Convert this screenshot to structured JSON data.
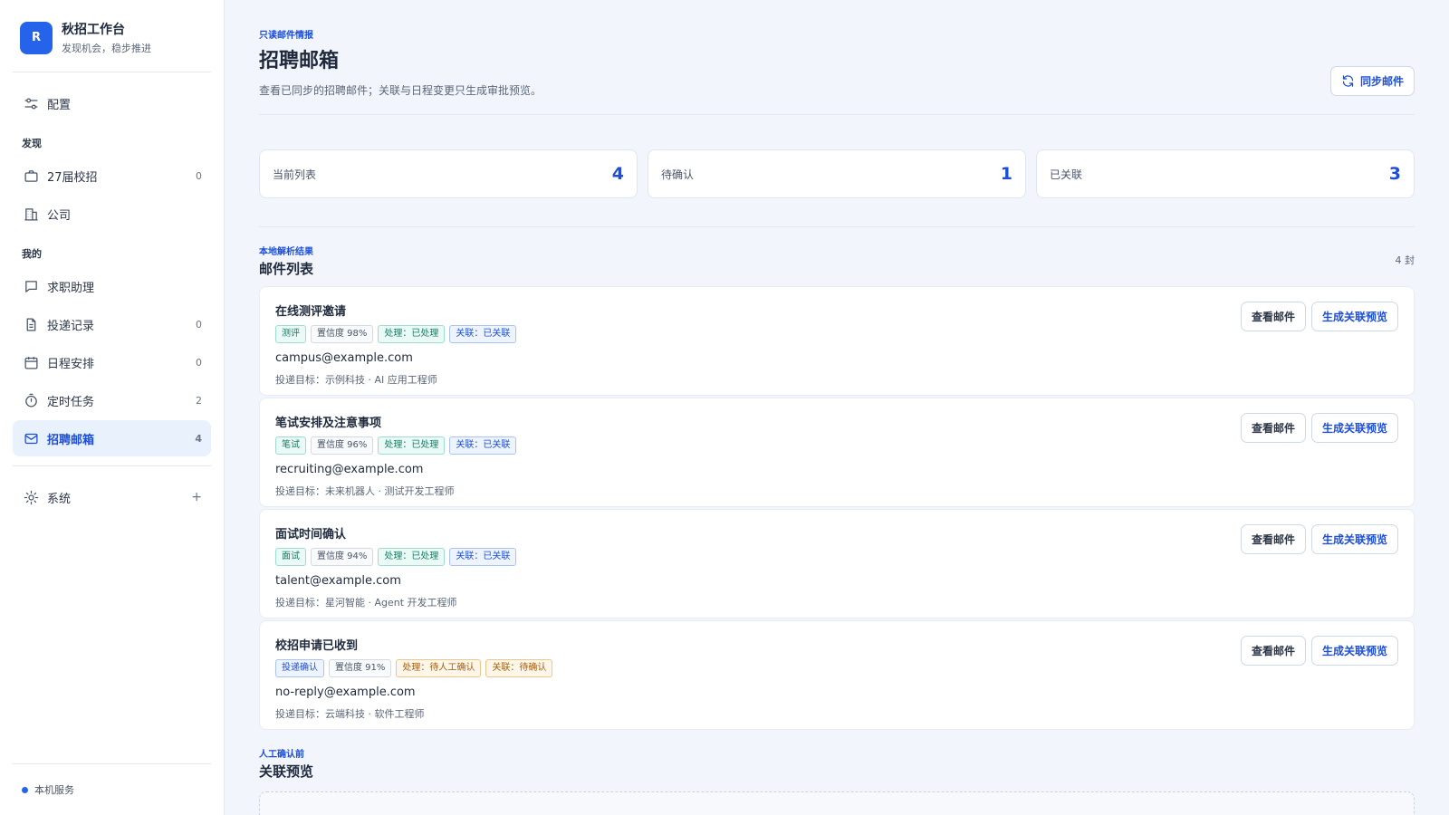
{
  "app": {
    "logo_letter": "R",
    "title": "秋招工作台",
    "subtitle": "发现机会，稳步推进"
  },
  "sidebar": {
    "config_label": "配置",
    "section_discover": "发现",
    "section_mine": "我的",
    "items": [
      {
        "label": "27届校招",
        "count": "0",
        "icon": "briefcase-icon"
      },
      {
        "label": "公司",
        "count": "",
        "icon": "building-icon"
      },
      {
        "label": "求职助理",
        "count": "",
        "icon": "chat-icon"
      },
      {
        "label": "投递记录",
        "count": "0",
        "icon": "document-icon"
      },
      {
        "label": "日程安排",
        "count": "0",
        "icon": "calendar-icon"
      },
      {
        "label": "定时任务",
        "count": "2",
        "icon": "timer-icon"
      },
      {
        "label": "招聘邮箱",
        "count": "4",
        "icon": "mail-icon",
        "active": true
      }
    ],
    "system_label": "系统",
    "system_expand": "+",
    "footer_label": "本机服务"
  },
  "header": {
    "eyebrow": "只读邮件情报",
    "title": "招聘邮箱",
    "description": "查看已同步的招聘邮件；关联与日程变更只生成审批预览。",
    "sync_label": "同步邮件"
  },
  "stats": [
    {
      "label": "当前列表",
      "value": "4"
    },
    {
      "label": "待确认",
      "value": "1"
    },
    {
      "label": "已关联",
      "value": "3"
    }
  ],
  "mail_section": {
    "eyebrow": "本地解析结果",
    "title": "邮件列表",
    "count": "4 封",
    "view_label": "查看邮件",
    "preview_label": "生成关联预览"
  },
  "mails": [
    {
      "title": "在线测评邀请",
      "tags": [
        {
          "text": "测评",
          "color": "green"
        },
        {
          "text": "置信度 98%",
          "color": "gray"
        },
        {
          "text": "处理：已处理",
          "color": "green"
        },
        {
          "text": "关联：已关联",
          "color": "blue"
        }
      ],
      "from": "campus@example.com",
      "target": "投递目标：示例科技 · AI 应用工程师"
    },
    {
      "title": "笔试安排及注意事项",
      "tags": [
        {
          "text": "笔试",
          "color": "green"
        },
        {
          "text": "置信度 96%",
          "color": "gray"
        },
        {
          "text": "处理：已处理",
          "color": "green"
        },
        {
          "text": "关联：已关联",
          "color": "blue"
        }
      ],
      "from": "recruiting@example.com",
      "target": "投递目标：未来机器人 · 测试开发工程师"
    },
    {
      "title": "面试时间确认",
      "tags": [
        {
          "text": "面试",
          "color": "green"
        },
        {
          "text": "置信度 94%",
          "color": "gray"
        },
        {
          "text": "处理：已处理",
          "color": "green"
        },
        {
          "text": "关联：已关联",
          "color": "blue"
        }
      ],
      "from": "talent@example.com",
      "target": "投递目标：星河智能 · Agent 开发工程师"
    },
    {
      "title": "校招申请已收到",
      "tags": [
        {
          "text": "投递确认",
          "color": "blue"
        },
        {
          "text": "置信度 91%",
          "color": "gray"
        },
        {
          "text": "处理：待人工确认",
          "color": "orange"
        },
        {
          "text": "关联：待确认",
          "color": "orange"
        }
      ],
      "from": "no-reply@example.com",
      "target": "投递目标：云端科技 · 软件工程师"
    }
  ],
  "preview_section": {
    "eyebrow": "人工确认前",
    "title": "关联预览"
  },
  "colors": {
    "accent": "#2563eb",
    "background": "#f2f6fc"
  }
}
